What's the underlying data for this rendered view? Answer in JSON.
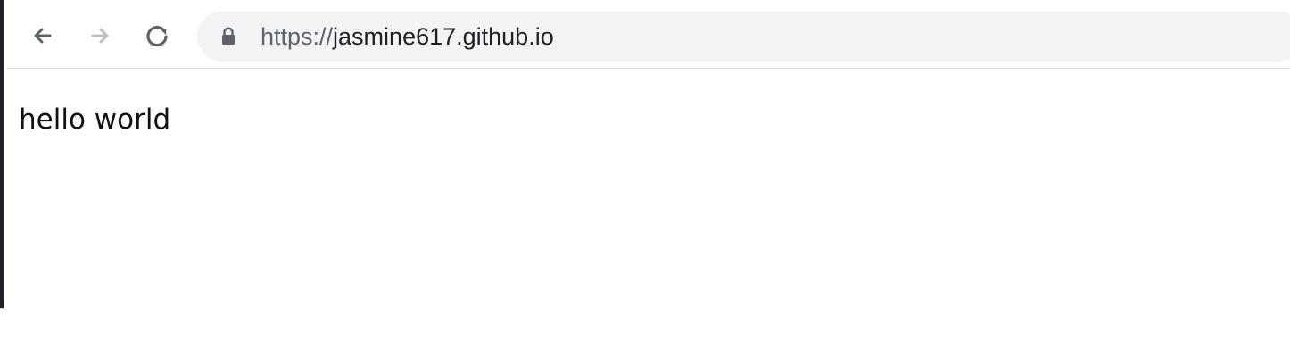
{
  "browser": {
    "toolbar": {
      "back_button": {
        "icon": "arrow-left-icon",
        "enabled": true
      },
      "forward_button": {
        "icon": "arrow-right-icon",
        "enabled": false
      },
      "reload_button": {
        "icon": "reload-icon",
        "enabled": true
      }
    },
    "address_bar": {
      "icon": "lock-icon",
      "scheme": "https://",
      "host": "jasmine617.github.io"
    },
    "colors": {
      "window_frame": "#202124",
      "address_bar_background": "#f1f3f4",
      "address_text": "#202124",
      "address_scheme": "#5f6368",
      "active_icon": "#5f6368",
      "disabled_icon": "#bdc1c6"
    }
  },
  "page": {
    "content_text": "hello world"
  }
}
